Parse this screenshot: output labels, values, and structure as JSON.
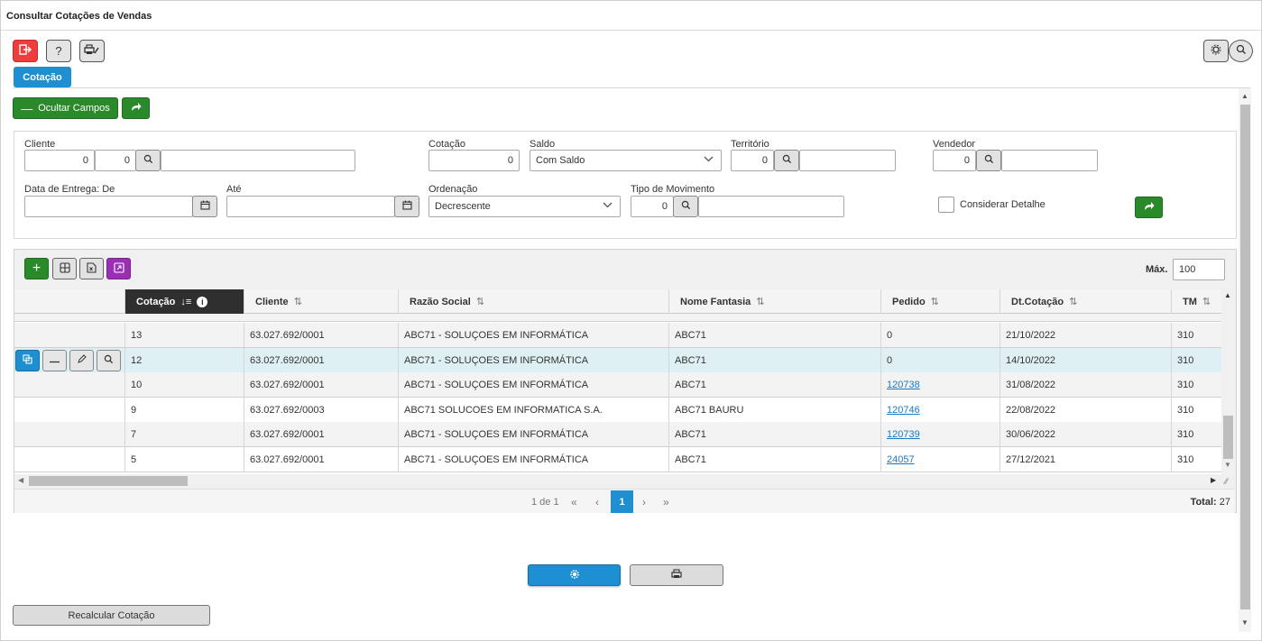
{
  "window": {
    "title": "Consultar Cotações de Vendas"
  },
  "toolbar": {
    "exit_icon": "exit-icon",
    "help_label": "?",
    "print_config_icon": "printer-settings-icon",
    "settings_icon": "gear-icon",
    "search_icon": "search-icon"
  },
  "tabs": [
    {
      "label": "Cotação"
    }
  ],
  "filters_toggle": {
    "label": "Ocultar Campos"
  },
  "filters": {
    "cliente": {
      "label": "Cliente",
      "code1": "0",
      "code2": "0",
      "name": ""
    },
    "cotacao": {
      "label": "Cotação",
      "value": "0"
    },
    "saldo": {
      "label": "Saldo",
      "selected": "Com Saldo"
    },
    "territorio": {
      "label": "Território",
      "code": "0",
      "name": ""
    },
    "vendedor": {
      "label": "Vendedor",
      "code": "0",
      "name": ""
    },
    "data_entrega_de": {
      "label": "Data de Entrega: De",
      "value": ""
    },
    "ate": {
      "label": "Até",
      "value": ""
    },
    "ordenacao": {
      "label": "Ordenação",
      "selected": "Decrescente"
    },
    "tipo_movimento": {
      "label": "Tipo de Movimento",
      "code": "0",
      "name": ""
    },
    "considerar_detalhe": {
      "label": "Considerar Detalhe",
      "checked": false
    }
  },
  "grid": {
    "max_label": "Máx.",
    "max_value": "100",
    "columns": [
      "Cotação",
      "Cliente",
      "Razão Social",
      "Nome Fantasia",
      "Pedido",
      "Dt.Cotação",
      "TM"
    ],
    "rows": [
      {
        "cotacao": "13",
        "cliente": "63.027.692/0001",
        "razao": "ABC71 - SOLUÇOES EM INFORMÁTICA",
        "fantasia": "ABC71",
        "pedido": "0",
        "pedido_link": false,
        "data": "21/10/2022",
        "tm": "310"
      },
      {
        "cotacao": "12",
        "cliente": "63.027.692/0001",
        "razao": "ABC71 - SOLUÇOES EM INFORMÁTICA",
        "fantasia": "ABC71",
        "pedido": "0",
        "pedido_link": false,
        "data": "14/10/2022",
        "tm": "310"
      },
      {
        "cotacao": "10",
        "cliente": "63.027.692/0001",
        "razao": "ABC71 - SOLUÇOES EM INFORMÁTICA",
        "fantasia": "ABC71",
        "pedido": "120738",
        "pedido_link": true,
        "data": "31/08/2022",
        "tm": "310"
      },
      {
        "cotacao": "9",
        "cliente": "63.027.692/0003",
        "razao": "ABC71 SOLUCOES EM INFORMATICA S.A.",
        "fantasia": "ABC71 BAURU",
        "pedido": "120746",
        "pedido_link": true,
        "data": "22/08/2022",
        "tm": "310"
      },
      {
        "cotacao": "7",
        "cliente": "63.027.692/0001",
        "razao": "ABC71 - SOLUÇOES EM INFORMÁTICA",
        "fantasia": "ABC71",
        "pedido": "120739",
        "pedido_link": true,
        "data": "30/06/2022",
        "tm": "310"
      },
      {
        "cotacao": "5",
        "cliente": "63.027.692/0001",
        "razao": "ABC71 - SOLUÇOES EM INFORMÁTICA",
        "fantasia": "ABC71",
        "pedido": "24057",
        "pedido_link": true,
        "data": "27/12/2021",
        "tm": "310"
      }
    ],
    "pager": {
      "info": "1 de 1",
      "current": "1",
      "total_label": "Total:",
      "total": "27"
    }
  },
  "actions": {
    "recalcular_label": "Recalcular Cotação"
  },
  "colors": {
    "accent": "#1e8fd0",
    "green": "#2a8a2a",
    "danger": "#ef3d3d",
    "purple": "#9a2fb5"
  }
}
